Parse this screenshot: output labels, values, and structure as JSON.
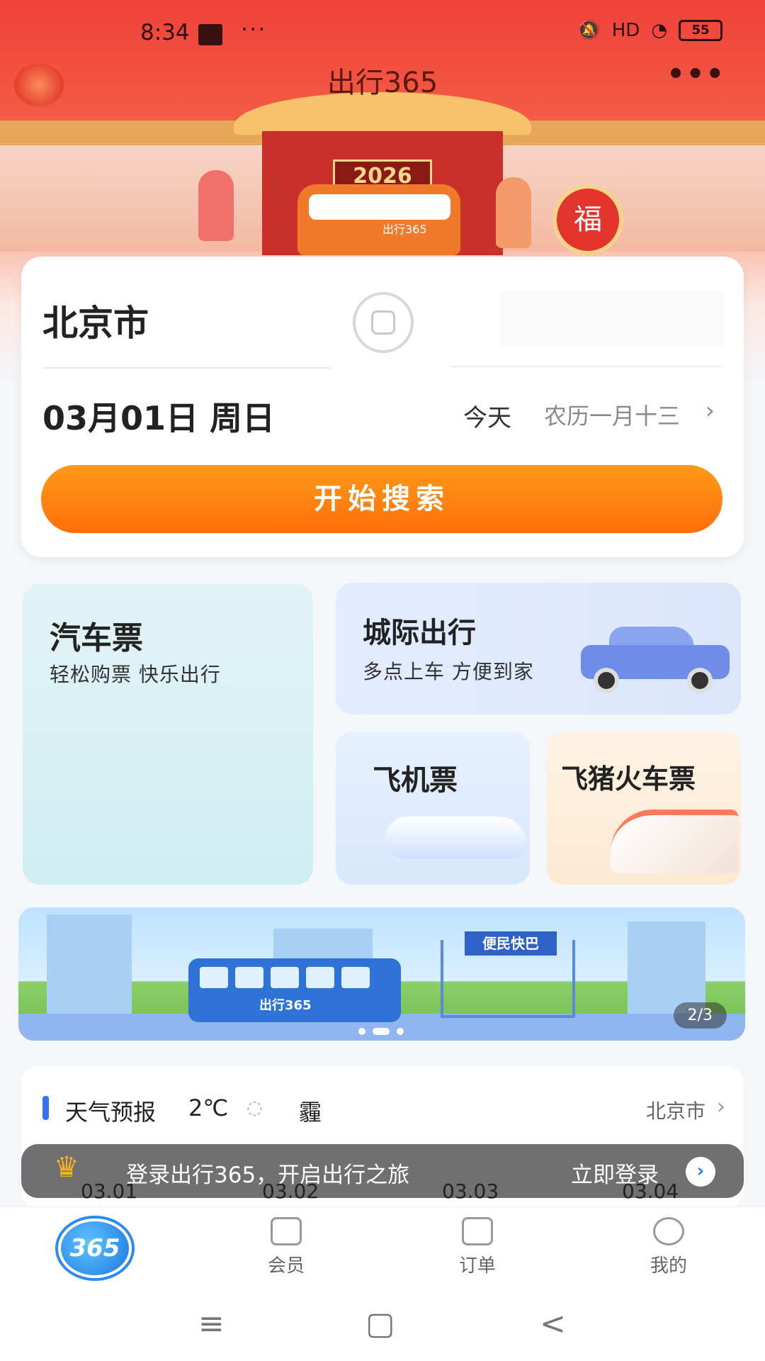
{
  "status_bar": {
    "time": "8:34",
    "dots": "···",
    "network": "HD",
    "battery": "55"
  },
  "header": {
    "title": "出行365",
    "more": "•••"
  },
  "hero": {
    "plaque": "2026",
    "bus_name": "出行365",
    "drum_char": "福"
  },
  "search_card": {
    "from_city": "北京市",
    "date": "03月01日 周日",
    "today": "今天",
    "lunar": "农历一月十三",
    "search_button": "开始搜索"
  },
  "services": {
    "bus": {
      "title": "汽车票",
      "subtitle": "轻松购票  快乐出行"
    },
    "intercity": {
      "title": "城际出行",
      "subtitle": "多点上车 方便到家"
    },
    "flight": {
      "title": "飞机票"
    },
    "train": {
      "title": "飞猪火车票"
    }
  },
  "banner": {
    "stop_sign": "便民快巴",
    "bus_name": "出行365",
    "pager": "2/3"
  },
  "weather": {
    "title": "天气预报",
    "temp": "2℃",
    "condition": "霾",
    "city": "北京市"
  },
  "login_bar": {
    "text": "登录出行365，开启出行之旅",
    "button": "立即登录"
  },
  "forecast_dates": [
    "03.01",
    "03.02",
    "03.03",
    "03.04"
  ],
  "tabbar": {
    "home_logo": "365",
    "member": "会员",
    "orders": "订单",
    "mine": "我的"
  },
  "nav": {
    "menu": "≡",
    "home": "▢",
    "back": "<"
  },
  "colors": {
    "accent": "#ff7a0e",
    "brand_blue": "#2a7af0",
    "hero_red": "#f0413a"
  }
}
